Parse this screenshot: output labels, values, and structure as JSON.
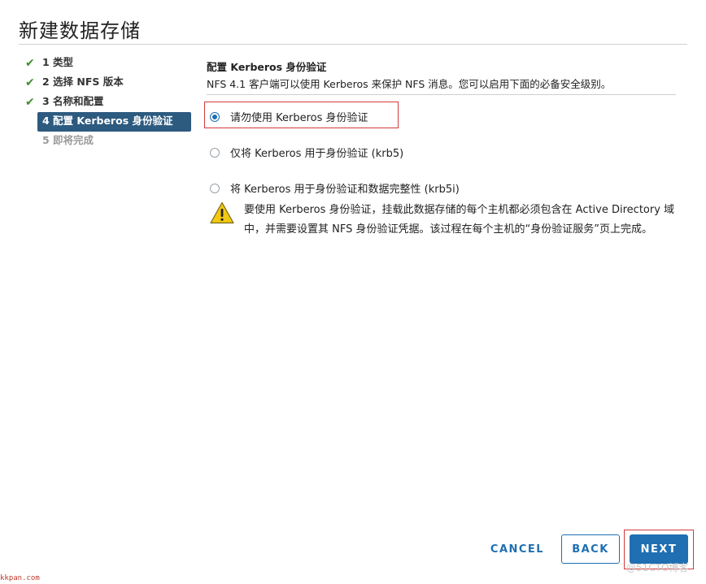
{
  "dialog": {
    "title": "新建数据存储"
  },
  "steps": [
    {
      "label": "1 类型",
      "state": "done"
    },
    {
      "label": "2 选择 NFS 版本",
      "state": "done"
    },
    {
      "label": "3 名称和配置",
      "state": "done"
    },
    {
      "label": "4 配置 Kerberos 身份验证",
      "state": "active"
    },
    {
      "label": "5 即将完成",
      "state": "pending"
    }
  ],
  "section": {
    "title": "配置 Kerberos 身份验证",
    "description": "NFS 4.1 客户端可以使用 Kerberos 来保护 NFS 消息。您可以启用下面的必备安全级别。"
  },
  "options": [
    {
      "label": "请勿使用 Kerberos 身份验证",
      "selected": true
    },
    {
      "label": "仅将 Kerberos 用于身份验证 (krb5)",
      "selected": false
    },
    {
      "label": "将 Kerberos 用于身份验证和数据完整性 (krb5i)",
      "selected": false
    }
  ],
  "warning": {
    "icon": "warning-icon",
    "text": "要使用 Kerberos 身份验证，挂载此数据存储的每个主机都必须包含在 Active Directory 域中，并需要设置其 NFS 身份验证凭据。该过程在每个主机的“身份验证服务”页上完成。"
  },
  "footer": {
    "cancel_label": "CANCEL",
    "back_label": "BACK",
    "next_label": "NEXT"
  },
  "watermarks": {
    "left": "kkpan.com",
    "right": "@51CTO博客"
  },
  "colors": {
    "accent": "#1f6fb2",
    "active_step_bg": "#2d5a7f",
    "check": "#3f8f2f",
    "highlight": "#d23a3a",
    "warning": "#f2c811"
  }
}
